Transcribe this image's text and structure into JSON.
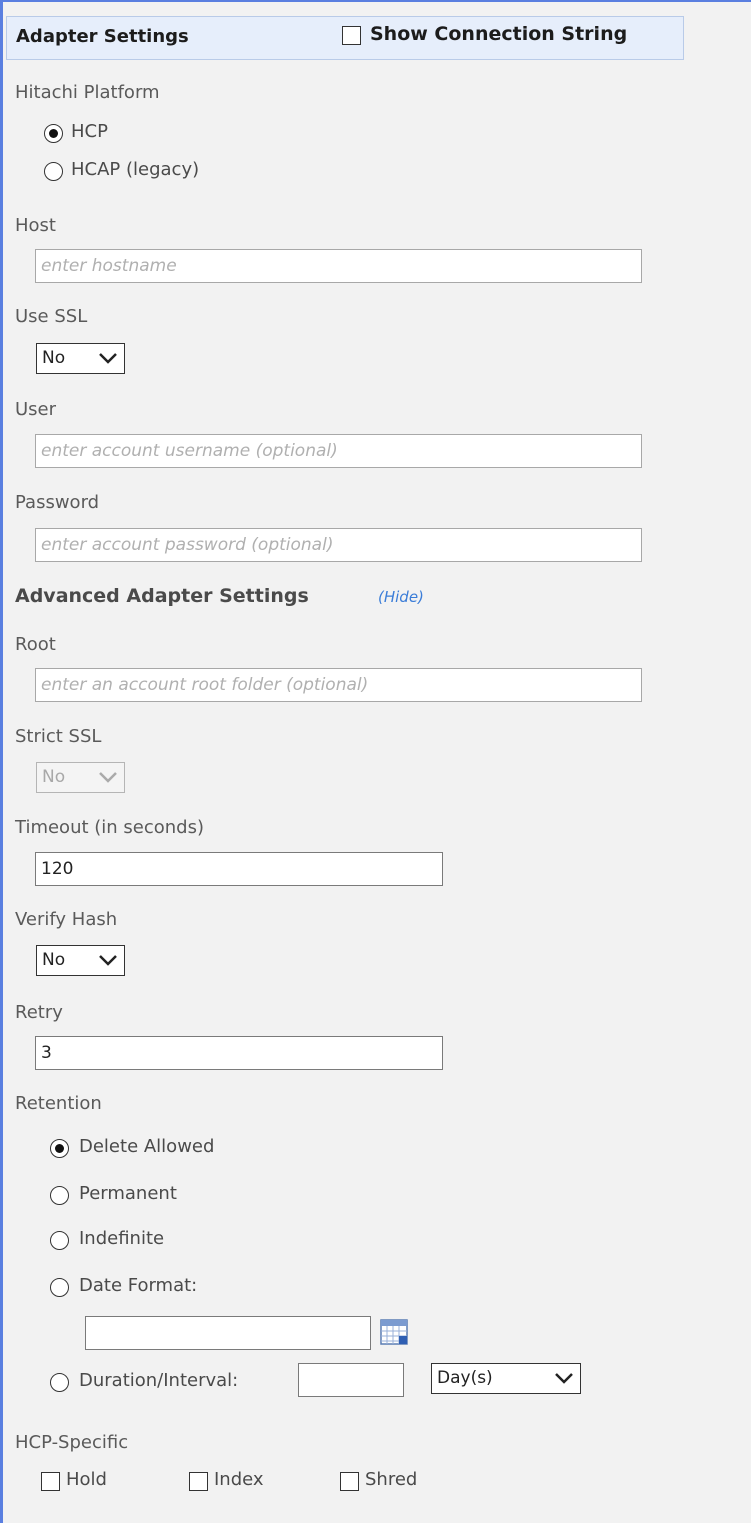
{
  "header": {
    "title": "Adapter Settings",
    "show_connection_string_label": "Show Connection String",
    "show_connection_string_checked": false
  },
  "platform": {
    "label": "Hitachi Platform",
    "options": [
      "HCP",
      "HCAP (legacy)"
    ],
    "selected": "HCP"
  },
  "host": {
    "label": "Host",
    "placeholder": "enter hostname",
    "value": ""
  },
  "use_ssl": {
    "label": "Use SSL",
    "value": "No"
  },
  "user": {
    "label": "User",
    "placeholder": "enter account username (optional)",
    "value": ""
  },
  "password": {
    "label": "Password",
    "placeholder": "enter account password (optional)",
    "value": ""
  },
  "advanced": {
    "title": "Advanced Adapter Settings",
    "toggle_label": "(Hide)"
  },
  "root": {
    "label": "Root",
    "placeholder": "enter an account root folder (optional)",
    "value": ""
  },
  "strict_ssl": {
    "label": "Strict SSL",
    "value": "No",
    "disabled": true
  },
  "timeout": {
    "label": "Timeout (in seconds)",
    "value": "120"
  },
  "verify_hash": {
    "label": "Verify Hash",
    "value": "No"
  },
  "retry": {
    "label": "Retry",
    "value": "3"
  },
  "retention": {
    "label": "Retention",
    "options": [
      "Delete Allowed",
      "Permanent",
      "Indefinite",
      "Date Format:",
      "Duration/Interval:"
    ],
    "selected": "Delete Allowed",
    "date_value": "",
    "duration_value": "",
    "duration_unit": "Day(s)"
  },
  "hcp_specific": {
    "label": "HCP-Specific",
    "options": [
      "Hold",
      "Index",
      "Shred"
    ]
  },
  "colors": {
    "panel_bg": "#f2f2f2",
    "panel_border": "#5a7fe0",
    "header_bg": "#e6eefb",
    "link": "#3b7dd8"
  },
  "icons": {
    "calendar": "calendar-icon",
    "chevron": "chevron-down-icon"
  }
}
